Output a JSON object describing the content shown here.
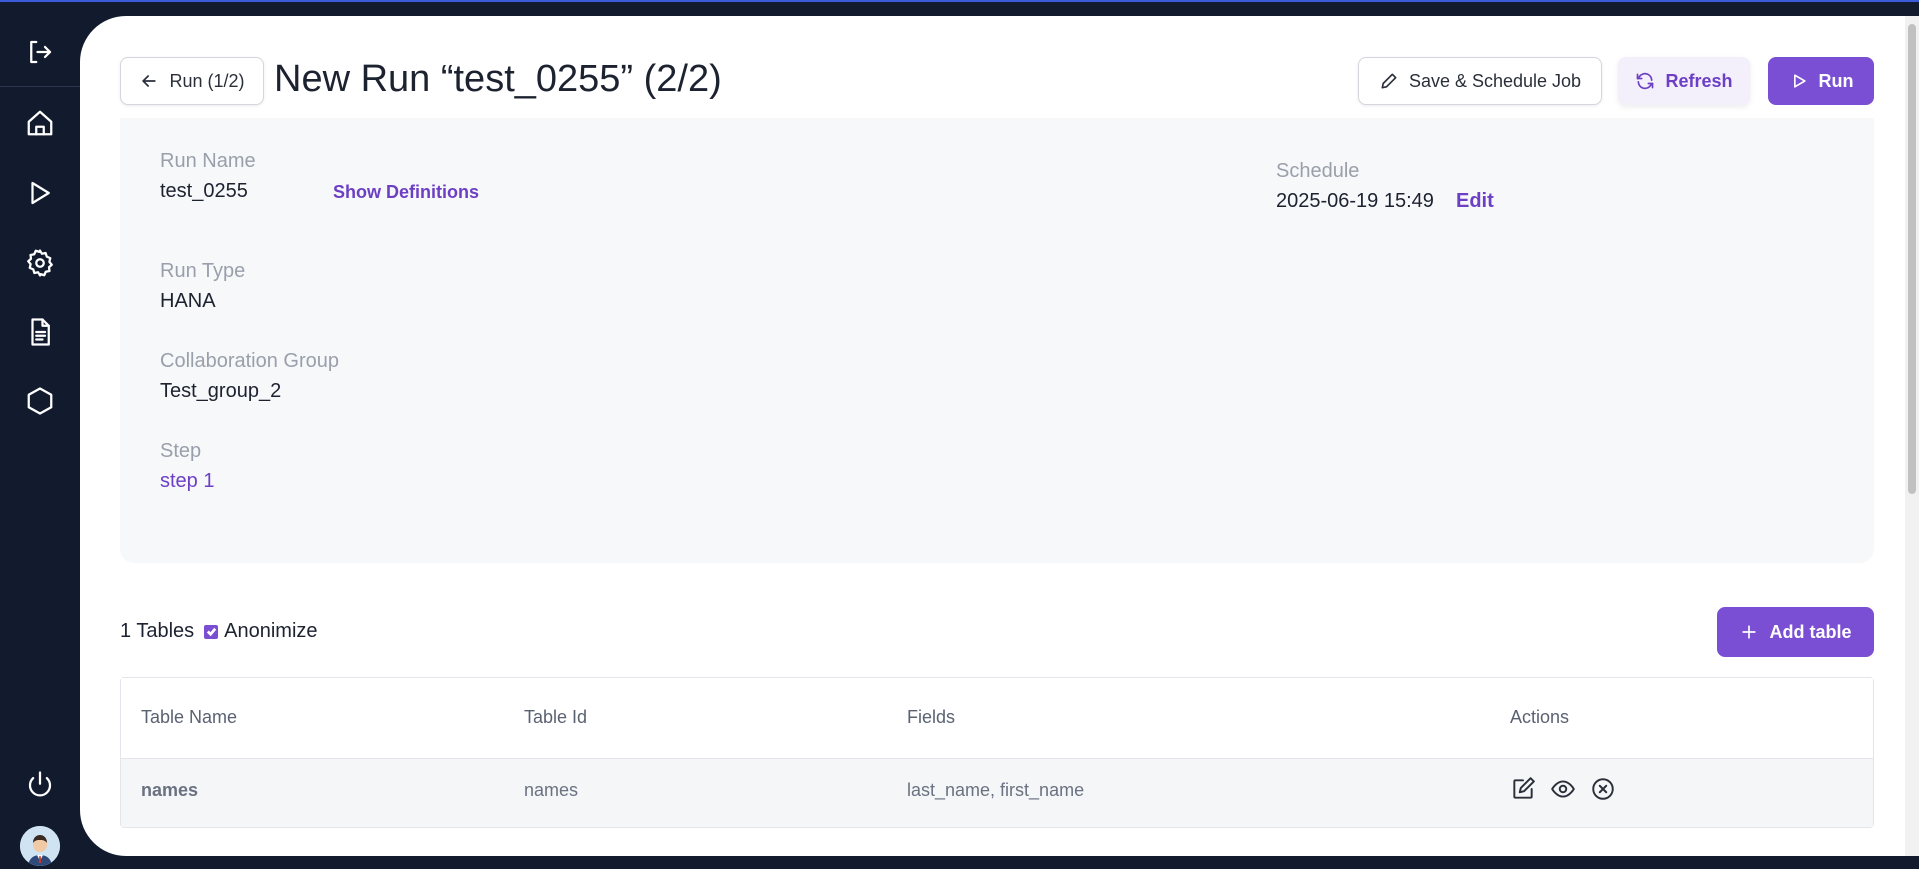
{
  "header": {
    "back_button": "Run (1/2)",
    "title": "New Run “test_0255” (2/2)",
    "save_schedule_button": "Save & Schedule Job",
    "refresh_button": "Refresh",
    "run_button": "Run"
  },
  "run_info": {
    "run_name_label": "Run Name",
    "run_name_value": "test_0255",
    "show_definitions_link": "Show Definitions",
    "run_type_label": "Run Type",
    "run_type_value": "HANA",
    "collaboration_group_label": "Collaboration Group",
    "collaboration_group_value": "Test_group_2",
    "step_label": "Step",
    "step_value": "step 1",
    "schedule_label": "Schedule",
    "schedule_value": "2025-06-19 15:49",
    "edit_link": "Edit"
  },
  "tables_section": {
    "count_text": "1 Tables",
    "anonymize_label": "Anonimize",
    "anonymize_checked": true,
    "add_table_button": "Add table",
    "columns": [
      "Table Name",
      "Table Id",
      "Fields",
      "Actions"
    ],
    "rows": [
      {
        "table_name": "names",
        "table_id": "names",
        "fields": "last_name, first_name"
      }
    ]
  },
  "sidebar": {
    "icons": [
      "logout-icon",
      "home-icon",
      "play-icon",
      "settings-icon",
      "document-icon",
      "hexagon-icon",
      "power-icon"
    ]
  },
  "colors": {
    "accent": "#7b4fd4",
    "sidebar_bg": "#121a2e",
    "card_bg": "#f7f8fa"
  }
}
